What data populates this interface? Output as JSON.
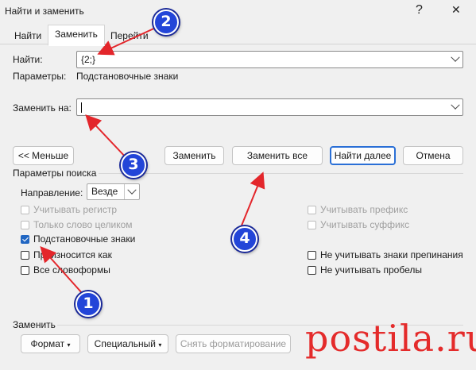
{
  "window": {
    "title": "Найти и заменить",
    "help_glyph": "?",
    "close_glyph": "✕"
  },
  "tabs": [
    {
      "label": "Найти"
    },
    {
      "label": "Заменить"
    },
    {
      "label": "Перейти"
    }
  ],
  "find": {
    "label": "Найти:",
    "value": "{2;}",
    "options_label": "Параметры:",
    "options_value": "Подстановочные знаки"
  },
  "replace": {
    "label": "Заменить на:",
    "value": ""
  },
  "buttons": {
    "less": "<< Меньше",
    "replace": "Заменить",
    "replace_all": "Заменить все",
    "find_next": "Найти далее",
    "cancel": "Отмена"
  },
  "search_options": {
    "title": "Параметры поиска",
    "direction_label": "Направление:",
    "direction_value": "Везде",
    "left": [
      {
        "label": "Учитывать регистр",
        "checked": false,
        "disabled": true
      },
      {
        "label": "Только слово целиком",
        "checked": false,
        "disabled": true
      },
      {
        "label": "Подстановочные знаки",
        "checked": true,
        "disabled": false
      },
      {
        "label": "Произносится как",
        "checked": false,
        "disabled": false
      },
      {
        "label": "Все словоформы",
        "checked": false,
        "disabled": false
      }
    ],
    "right": [
      {
        "label": "Учитывать префикс",
        "checked": false,
        "disabled": true
      },
      {
        "label": "Учитывать суффикс",
        "checked": false,
        "disabled": true
      },
      {
        "label": "Не учитывать знаки препинания",
        "checked": false,
        "disabled": false
      },
      {
        "label": "Не учитывать пробелы",
        "checked": false,
        "disabled": false
      }
    ]
  },
  "replace_section": {
    "title": "Заменить",
    "format": "Формат",
    "special": "Специальный",
    "clear_format": "Снять форматирование"
  },
  "callouts": [
    "1",
    "2",
    "3",
    "4"
  ],
  "watermark": "postila.ru",
  "colors": {
    "accent": "#2a6fd6",
    "callout": "#2345d8",
    "arrow": "#e3262b",
    "watermark": "#e42b2b"
  }
}
